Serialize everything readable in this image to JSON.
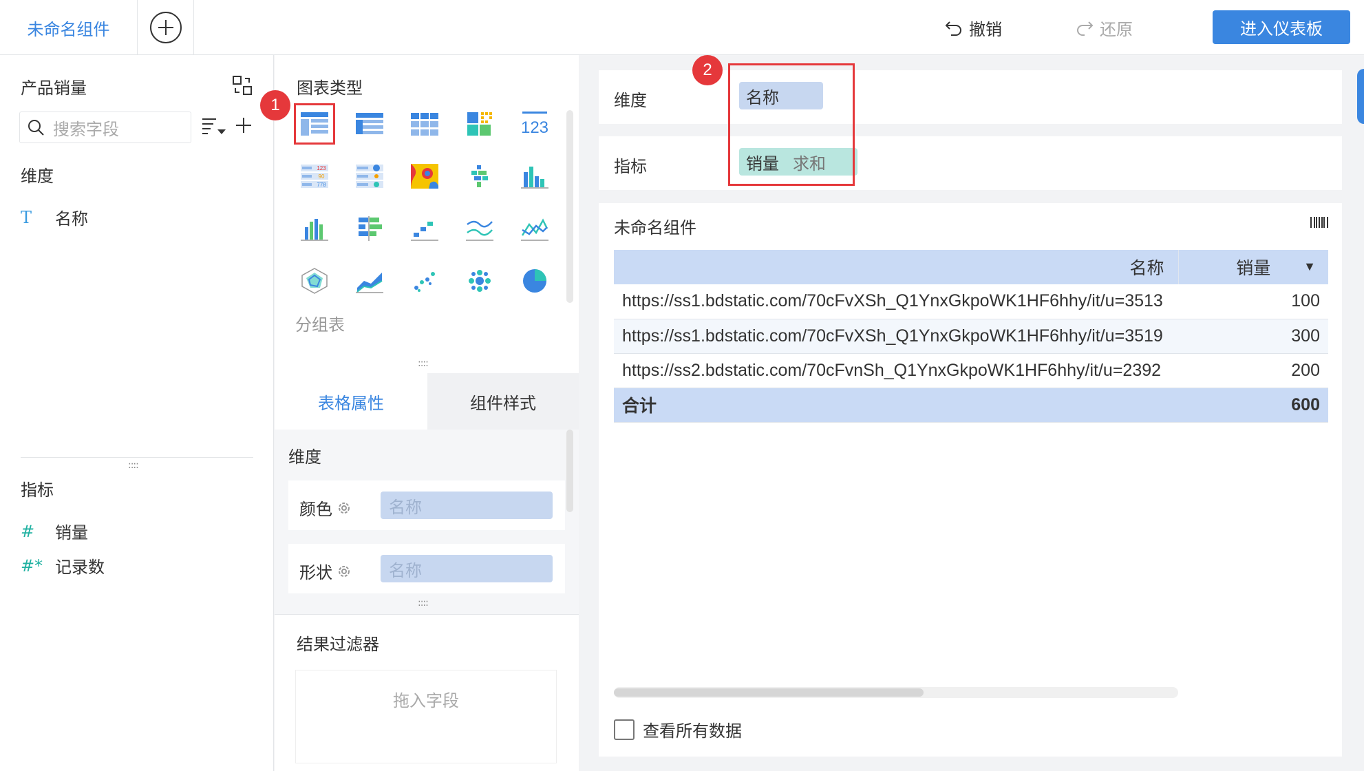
{
  "topbar": {
    "active_tab": "未命名组件",
    "undo_label": "撤销",
    "redo_label": "还原",
    "enter_dashboard_label": "进入仪表板"
  },
  "left_panel": {
    "dataset_title": "产品销量",
    "search_placeholder": "搜索字段",
    "dimension_section": "维度",
    "dimensions": [
      {
        "type_glyph": "T",
        "name": "名称"
      }
    ],
    "measure_section": "指标",
    "measures": [
      {
        "type_glyph": "#",
        "name": "销量"
      },
      {
        "type_glyph": "#*",
        "name": "记录数"
      }
    ]
  },
  "middle_panel": {
    "chart_type_title": "图表类型",
    "chart_types": [
      "grouped-table",
      "detail-table",
      "cross-table",
      "color-table",
      "kpi-number",
      "kpi-indicator",
      "dot-table",
      "heatmap",
      "custom-bar",
      "column-chart",
      "column-grouped",
      "bar-chart",
      "step-chart",
      "line-chart",
      "line-area",
      "radar-chart",
      "area-chart",
      "scatter-chart",
      "bubble-chart",
      "pie-chart"
    ],
    "selected_chart_label": "分组表",
    "tabs": [
      "表格属性",
      "组件样式"
    ],
    "props_dimension_label": "维度",
    "prop_rows": [
      {
        "label": "颜色",
        "value": "名称"
      },
      {
        "label": "形状",
        "value": "名称"
      }
    ],
    "result_filter_title": "结果过滤器",
    "drop_field_placeholder": "拖入字段"
  },
  "config": {
    "dimension_label": "维度",
    "dimension_field": "名称",
    "measure_label": "指标",
    "measure_field": "销量",
    "measure_agg": "求和",
    "badge_1": "1",
    "badge_2": "2"
  },
  "widget": {
    "title": "未命名组件",
    "columns": [
      "名称",
      "销量"
    ],
    "rows": [
      {
        "name": "https://ss1.bdstatic.com/70cFvXSh_Q1YnxGkpoWK1HF6hhy/it/u=3513",
        "value": "100"
      },
      {
        "name": "https://ss1.bdstatic.com/70cFvXSh_Q1YnxGkpoWK1HF6hhy/it/u=3519",
        "value": "300"
      },
      {
        "name": "https://ss2.bdstatic.com/70cFvnSh_Q1YnxGkpoWK1HF6hhy/it/u=2392",
        "value": "200"
      }
    ],
    "total_label": "合计",
    "total_value": "600",
    "view_all_label": "查看所有数据"
  },
  "colors": {
    "accent": "#3a86e0",
    "highlight_red": "#e5383b",
    "dimension_pill": "#c7d7f0",
    "measure_pill": "#b9e6df"
  }
}
